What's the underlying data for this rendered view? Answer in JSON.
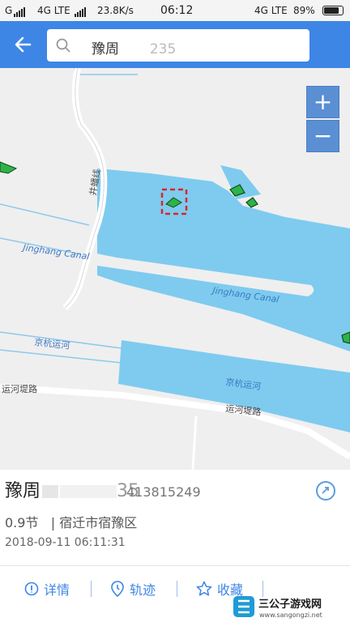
{
  "status_bar": {
    "carrier_left": "G",
    "network_left": "4G LTE",
    "speed": "23.8K/s",
    "time": "06:12",
    "network_right": "4G LTE",
    "battery": "89%",
    "battery_level": 0.89
  },
  "header": {
    "search_value": "豫周",
    "search_ghost": "235"
  },
  "map": {
    "labels": {
      "rail": "井蟠线",
      "canal_en_1": "Jinghang Canal",
      "canal_en_2": "Jinghang Canal",
      "canal_cn_1": "京杭运河",
      "canal_cn_2": "京杭运河",
      "road_1": "运河堤路",
      "road_2": "运河堤路"
    },
    "zoom_in": "+",
    "zoom_out": "−",
    "colors": {
      "land": "#efefef",
      "water": "#7ecbef",
      "road": "#ffffff",
      "vessel": "#2db34a",
      "selection": "#d9262c"
    }
  },
  "vessel": {
    "name": "豫周",
    "name_tail": "35",
    "mmsi": "413815249",
    "speed": "0.9节",
    "location": "| 宿迁市宿豫区",
    "timestamp": "2018-09-11 06:11:31"
  },
  "toolbar": {
    "details": "详情",
    "track": "轨迹",
    "favorite": "收藏",
    "sep": "|"
  },
  "watermark": {
    "brand": "三公子游戏网",
    "url": "www.sangongzi.net"
  }
}
